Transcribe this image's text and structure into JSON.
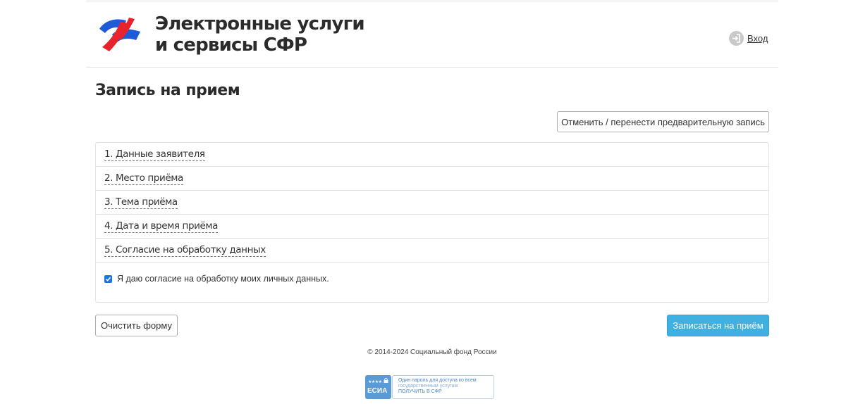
{
  "header": {
    "title_line1": "Электронные услуги",
    "title_line2": "и сервисы СФР",
    "logo_icon": "sfr-logo-icon",
    "login_label": "Вход",
    "login_icon": "login-icon"
  },
  "page_title": "Запись на прием",
  "actions": {
    "cancel_label": "Отменить / перенести предварительную запись",
    "clear_label": "Очистить форму",
    "submit_label": "Записаться на приём"
  },
  "steps": [
    {
      "label": "1. Данные заявителя"
    },
    {
      "label": "2. Место приёма"
    },
    {
      "label": "3. Тема приёма"
    },
    {
      "label": "4. Дата и время приёма"
    },
    {
      "label": "5. Согласие на обработку данных"
    }
  ],
  "consent": {
    "label": "Я даю согласие на обработку моих личных данных.",
    "checked": true
  },
  "footer": {
    "copyright": "© 2014-2024 Социальный фонд России"
  },
  "esia": {
    "badge_stars": "★★★★",
    "badge_label": "ЕСИА",
    "line1": "Один пароль для доступа ко всем",
    "line2": "государственным услугам",
    "line3": "ПОЛУЧИТЬ В СФР"
  },
  "colors": {
    "accent": "#3fb0e0",
    "logo_blue": "#1f5bd8",
    "logo_red": "#e8232c",
    "checkbox": "#1a73e8",
    "esia_blue": "#5b9bd5"
  }
}
